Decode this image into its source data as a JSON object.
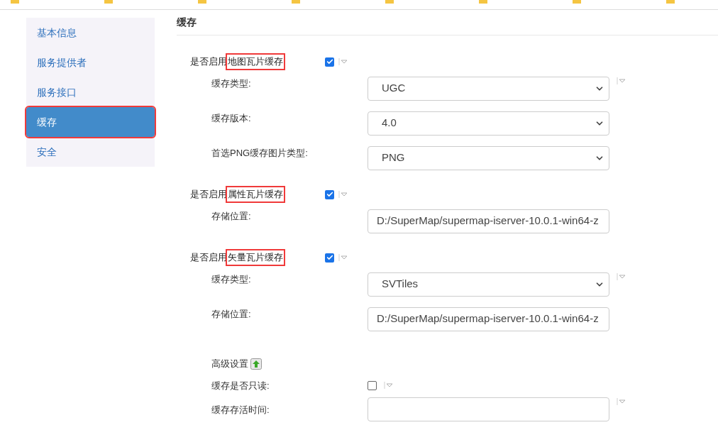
{
  "sidebar": {
    "items": [
      {
        "label": "基本信息",
        "selected": false,
        "highlighted": false
      },
      {
        "label": "服务提供者",
        "selected": false,
        "highlighted": false
      },
      {
        "label": "服务接口",
        "selected": false,
        "highlighted": false
      },
      {
        "label": "缓存",
        "selected": true,
        "highlighted": true
      },
      {
        "label": "安全",
        "selected": false,
        "highlighted": false
      }
    ]
  },
  "page_title": "缓存",
  "sections": [
    {
      "prefix": "是否启用",
      "term": "地图瓦片缓存",
      "highlighted": true,
      "checked": true,
      "fields": [
        {
          "label": "缓存类型:",
          "kind": "select",
          "value": "UGC",
          "menu_marker": true
        },
        {
          "label": "缓存版本:",
          "kind": "select",
          "value": "4.0",
          "menu_marker": false
        },
        {
          "label": "首选PNG缓存图片类型:",
          "kind": "select",
          "value": "PNG",
          "menu_marker": false
        }
      ]
    },
    {
      "prefix": "是否启用",
      "term": "属性瓦片缓存",
      "highlighted": true,
      "checked": true,
      "fields": [
        {
          "label": "存储位置:",
          "kind": "input",
          "value": "D:/SuperMap/supermap-iserver-10.0.1-win64-z",
          "menu_marker": false
        }
      ]
    },
    {
      "prefix": "是否启用",
      "term": "矢量瓦片缓存",
      "highlighted": true,
      "checked": true,
      "fields": [
        {
          "label": "缓存类型:",
          "kind": "select",
          "value": "SVTiles",
          "menu_marker": true
        },
        {
          "label": "存储位置:",
          "kind": "input",
          "value": "D:/SuperMap/supermap-iserver-10.0.1-win64-z",
          "menu_marker": false
        }
      ]
    }
  ],
  "advanced": {
    "label": "高级设置",
    "fields": [
      {
        "label": "缓存是否只读:",
        "kind": "checkbox",
        "checked": false,
        "menu_marker": true
      },
      {
        "label": "缓存存活时间:",
        "kind": "input",
        "menu_marker": true
      }
    ]
  }
}
